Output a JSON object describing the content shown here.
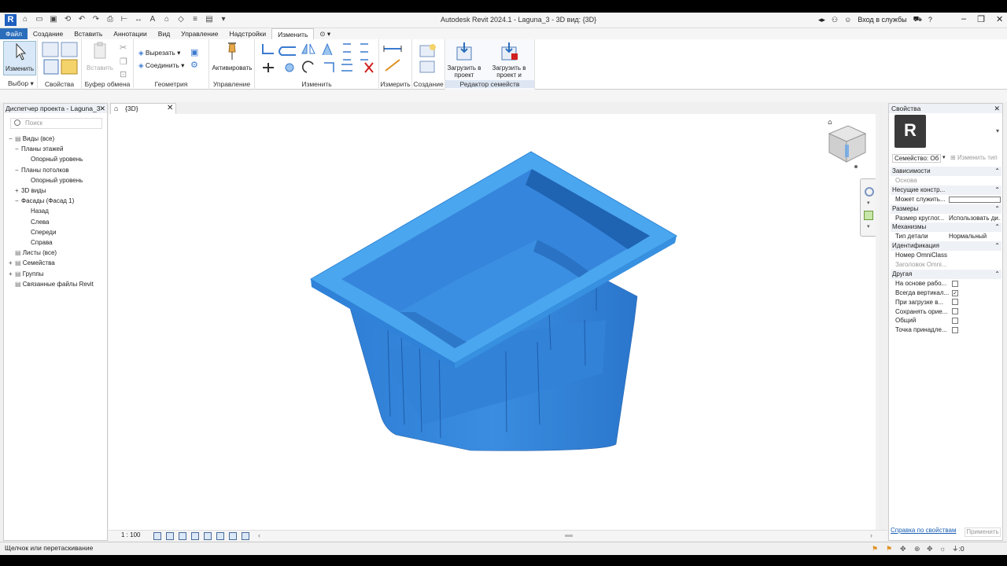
{
  "titlebar": {
    "app_title": "Autodesk Revit 2024.1 - Laguna_3 - 3D вид: {3D}",
    "sign_in": "Вход в службы"
  },
  "ribbon": {
    "tabs": [
      "Файл",
      "Создание",
      "Вставить",
      "Аннотации",
      "Вид",
      "Управление",
      "Надстройки",
      "Изменить"
    ],
    "active_tab": "Изменить",
    "panels": {
      "select": {
        "label": "Выбор",
        "modify_button": "Изменить"
      },
      "properties": {
        "label": "Свойства"
      },
      "clipboard": {
        "label": "Буфер обмена",
        "paste_button": "Вставить"
      },
      "geometry": {
        "label": "Геометрия",
        "cut_button": "Вырезать",
        "join_button": "Соединить"
      },
      "manage": {
        "label": "Управление",
        "activate_button": "Активировать"
      },
      "modify": {
        "label": "Изменить"
      },
      "measure": {
        "label": "Измерить"
      },
      "create": {
        "label": "Создание"
      },
      "family_editor": {
        "label": "Редактор семейств",
        "load_button": "Загрузить в проект",
        "load_close_button": "Загрузить в проект и закрыть"
      }
    }
  },
  "project_browser": {
    "title": "Диспетчер проекта - Laguna_3",
    "search_placeholder": "Поиск",
    "items": [
      {
        "label": "Виды (все)",
        "toggle": "−",
        "level": 0
      },
      {
        "label": "Планы этажей",
        "toggle": "−",
        "level": 1
      },
      {
        "label": "Опорный уровень",
        "toggle": "",
        "level": 2
      },
      {
        "label": "Планы потолков",
        "toggle": "−",
        "level": 1
      },
      {
        "label": "Опорный уровень",
        "toggle": "",
        "level": 2
      },
      {
        "label": "3D виды",
        "toggle": "+",
        "level": 1
      },
      {
        "label": "Фасады (Фасад 1)",
        "toggle": "−",
        "level": 1
      },
      {
        "label": "Назад",
        "toggle": "",
        "level": 2
      },
      {
        "label": "Слева",
        "toggle": "",
        "level": 2
      },
      {
        "label": "Спереди",
        "toggle": "",
        "level": 2
      },
      {
        "label": "Справа",
        "toggle": "",
        "level": 2
      },
      {
        "label": "Листы (все)",
        "toggle": "",
        "level": 0
      },
      {
        "label": "Семейства",
        "toggle": "+",
        "level": 0
      },
      {
        "label": "Группы",
        "toggle": "+",
        "level": 0
      },
      {
        "label": "Связанные файлы Revit",
        "toggle": "",
        "level": 0
      }
    ]
  },
  "view": {
    "tab_label": "{3D}",
    "scale": "1 : 100",
    "model_color": "#3a8de0",
    "model_top_color": "#4aa6ee"
  },
  "properties": {
    "title": "Свойства",
    "family_selector": "Семейство: Об",
    "edit_type": "Изменить тип",
    "rows": [
      {
        "type": "group",
        "name": "Зависимости"
      },
      {
        "type": "prop",
        "name": "Основа",
        "value": "",
        "disabled": true
      },
      {
        "type": "group",
        "name": "Несущие констр..."
      },
      {
        "type": "prop",
        "name": "Может служить...",
        "value": "",
        "check": "box"
      },
      {
        "type": "group",
        "name": "Размеры"
      },
      {
        "type": "prop",
        "name": "Размер круглог...",
        "value": "Использовать ди..."
      },
      {
        "type": "group",
        "name": "Механизмы"
      },
      {
        "type": "prop",
        "name": "Тип детали",
        "value": "Нормальный"
      },
      {
        "type": "group",
        "name": "Идентификация"
      },
      {
        "type": "prop",
        "name": "Номер OmniClass",
        "value": ""
      },
      {
        "type": "prop",
        "name": "Заголовок Omni...",
        "value": "",
        "disabled": true
      },
      {
        "type": "group",
        "name": "Другая"
      },
      {
        "type": "prop",
        "name": "На основе рабо...",
        "value": "",
        "check": "unchecked"
      },
      {
        "type": "prop",
        "name": "Всегда вертикал...",
        "value": "",
        "check": "checked"
      },
      {
        "type": "prop",
        "name": "При загрузке в...",
        "value": "",
        "check": "unchecked"
      },
      {
        "type": "prop",
        "name": "Сохранять орие...",
        "value": "",
        "check": "unchecked"
      },
      {
        "type": "prop",
        "name": "Общий",
        "value": "",
        "check": "unchecked"
      },
      {
        "type": "prop",
        "name": "Точка принадле...",
        "value": "",
        "check": "unchecked"
      }
    ],
    "help_link": "Справка по свойствам",
    "apply_button": "Применить"
  },
  "statusbar": {
    "text": "Щелчок или перетаскивание",
    "filter_count": ":0"
  }
}
